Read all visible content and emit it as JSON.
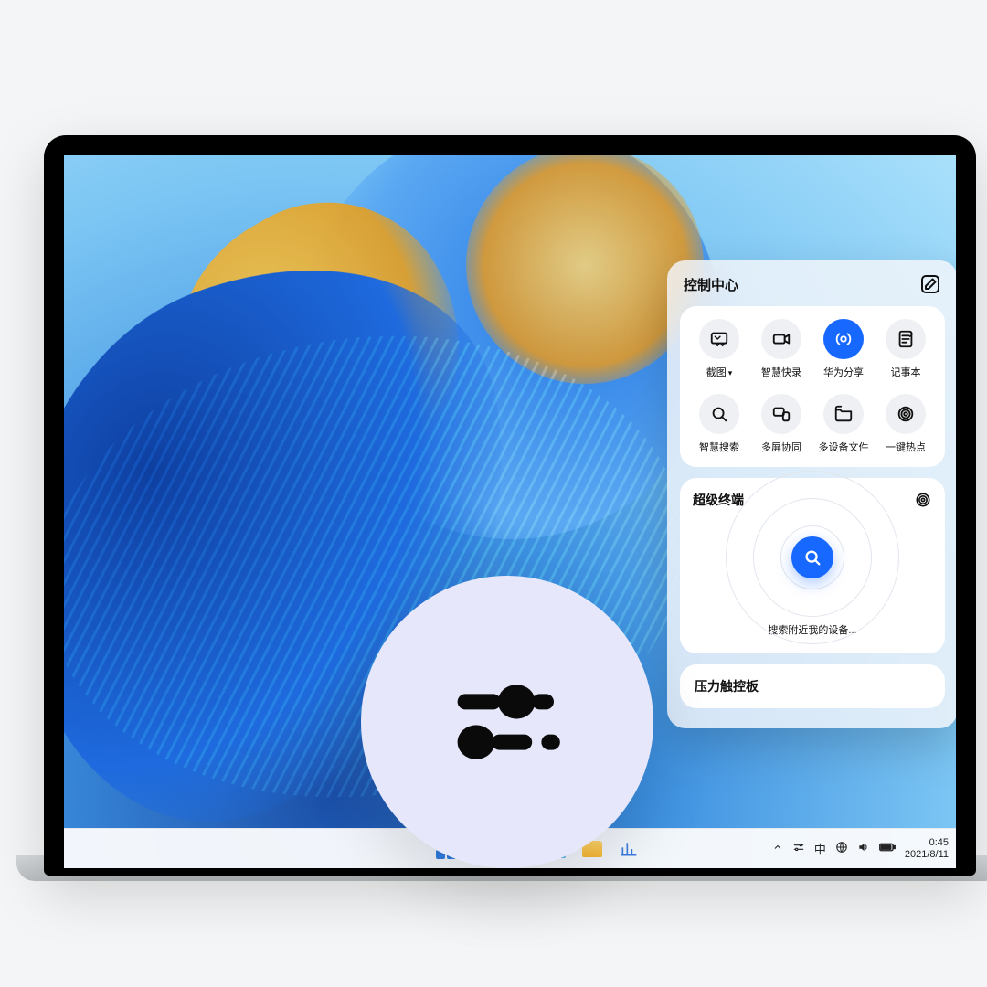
{
  "control_center": {
    "title": "控制中心",
    "edit_icon": "edit",
    "items": [
      {
        "icon": "screenshot",
        "label": "截图",
        "has_dropdown": true,
        "active": false
      },
      {
        "icon": "record",
        "label": "智慧快录",
        "has_dropdown": false,
        "active": false
      },
      {
        "icon": "share",
        "label": "华为分享",
        "has_dropdown": false,
        "active": true
      },
      {
        "icon": "notepad",
        "label": "记事本",
        "has_dropdown": false,
        "active": false
      },
      {
        "icon": "search",
        "label": "智慧搜索",
        "has_dropdown": false,
        "active": false
      },
      {
        "icon": "multiscreen",
        "label": "多屏协同",
        "has_dropdown": false,
        "active": false
      },
      {
        "icon": "files",
        "label": "多设备文件",
        "has_dropdown": false,
        "active": false
      },
      {
        "icon": "hotspot",
        "label": "一键热点",
        "has_dropdown": false,
        "active": false
      }
    ]
  },
  "super_terminal": {
    "title": "超级终端",
    "caption": "搜索附近我的设备..."
  },
  "force_touch": {
    "title": "压力触控板"
  },
  "taskbar": {
    "tray": {
      "ime": "中",
      "time": "0:45",
      "date": "2021/8/11"
    }
  }
}
